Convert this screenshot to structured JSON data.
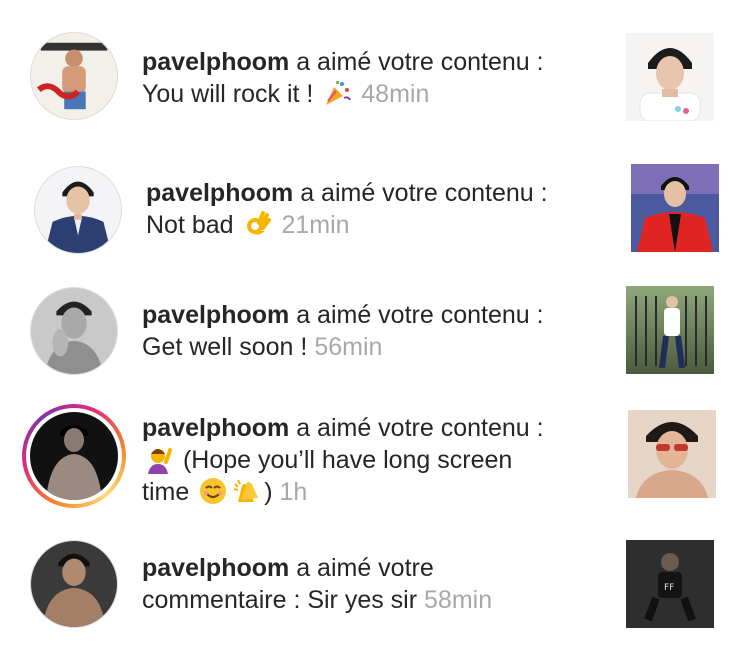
{
  "activity": {
    "items": [
      {
        "username": "pavelphoom",
        "action": " a aimé votre contenu :",
        "comment": "You will rock it !",
        "time": "48min"
      },
      {
        "username": "pavelphoom",
        "action": " a aimé votre contenu :",
        "comment": "Not bad",
        "time": "21min"
      },
      {
        "username": "pavelphoom",
        "action": " a aimé votre contenu :",
        "comment": "Get well soon !",
        "time": "56min"
      },
      {
        "username": "pavelphoom",
        "action": " a aimé votre contenu :",
        "comment_part1": "(Hope you’ll have long screen",
        "comment_part2": "time",
        "comment_part3": ")",
        "time": "1h"
      },
      {
        "username": "pavelphoom",
        "action": " a aimé votre",
        "action_line2": "commentaire : Sir yes sir",
        "time": "58min"
      }
    ]
  },
  "icons": {
    "party": "party-popper-icon",
    "ok": "ok-hand-icon",
    "raise": "person-raising-hand-icon",
    "smile": "smiling-face-icon",
    "clap": "clapping-hands-icon"
  },
  "colors": {
    "username": "#262626",
    "text": "#262626",
    "timestamp": "#a8a8a8"
  }
}
